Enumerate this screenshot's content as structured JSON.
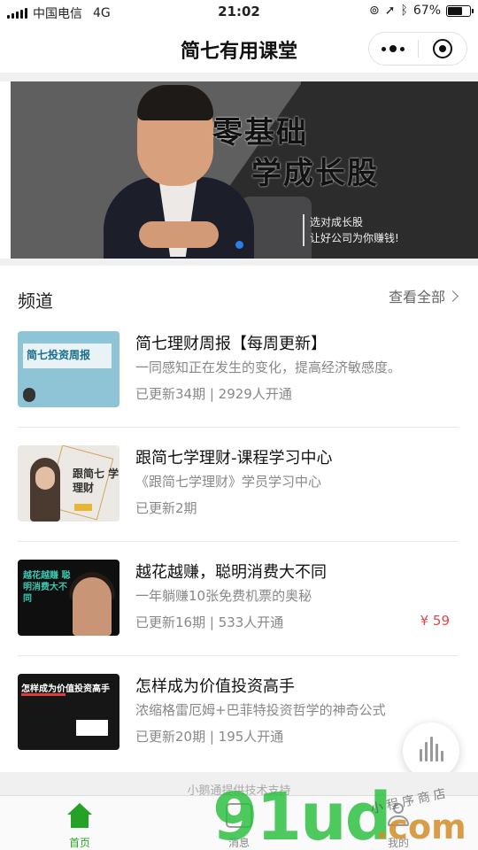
{
  "status_bar": {
    "carrier": "中国电信",
    "network": "4G",
    "time": "21:02",
    "battery": "67%",
    "battery_level": 0.67
  },
  "nav": {
    "title": "简七有用课堂",
    "more_icon": "more-dots-icon",
    "close_icon": "target-icon"
  },
  "banner": {
    "title_line1": "零基础",
    "title_line2": "学成长股",
    "subtitle_line1": "选对成长股",
    "subtitle_line2": "让好公司为你赚钱!"
  },
  "channel": {
    "title": "频道",
    "see_all": "查看全部"
  },
  "items": [
    {
      "title": "简七理财周报【每周更新】",
      "desc": "一同感知正在发生的变化，提高经济敏感度。",
      "meta": "已更新34期 | 2929人开通",
      "price": "",
      "thumb_text": "简七投资周报"
    },
    {
      "title": "跟简七学理财-课程学习中心",
      "desc": "《跟简七学理财》学员学习中心",
      "meta": "已更新2期",
      "price": "",
      "thumb_text": "跟简七 学理财"
    },
    {
      "title": "越花越赚，聪明消费大不同",
      "desc": "一年躺赚10张免费机票的奥秘",
      "meta": "已更新16期 | 533人开通",
      "price": "¥ 59",
      "thumb_text": "越花越赚 聪明消费大不同"
    },
    {
      "title": "怎样成为价值投资高手",
      "desc": "浓缩格雷厄姆+巴菲特投资哲学的神奇公式",
      "meta": "已更新20期 | 195人开通",
      "price": "",
      "thumb_text": "怎样成为价值投资高手"
    }
  ],
  "footer_note": "小鹅通提供技术支持",
  "tabs": [
    {
      "label": "首页",
      "icon": "home-icon",
      "active": true
    },
    {
      "label": "消息",
      "icon": "message-icon",
      "active": false
    },
    {
      "label": "我的",
      "icon": "profile-icon",
      "active": false
    }
  ],
  "watermark": {
    "main": "91ud",
    "suffix": ".com",
    "small": "小程序商店"
  },
  "colors": {
    "accent_green": "#25a225",
    "price_red": "#e04848",
    "banner_dot": "#2b7de9"
  }
}
